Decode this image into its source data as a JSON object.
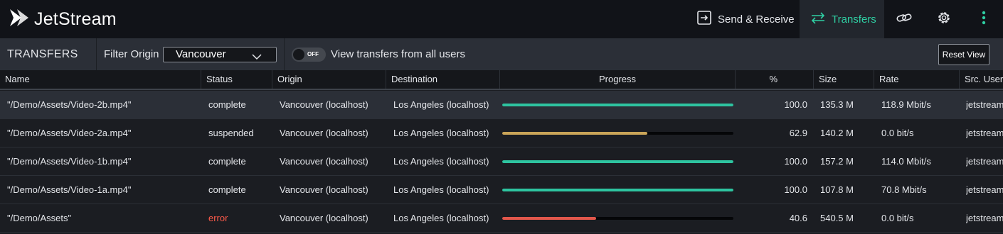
{
  "app": {
    "name": "JetStream"
  },
  "nav": {
    "send_receive": "Send & Receive",
    "transfers": "Transfers",
    "link_icon": "link-icon",
    "settings_icon": "gear-icon",
    "more_icon": "more-vertical-icon"
  },
  "toolbar": {
    "title": "TRANSFERS",
    "filter_label": "Filter Origin",
    "filter_value": "Vancouver",
    "toggle_state": "OFF",
    "toggle_label": "View transfers from all users",
    "reset_label": "Reset View"
  },
  "table": {
    "columns": [
      "Name",
      "Status",
      "Origin",
      "Destination",
      "Progress",
      "%",
      "Size",
      "Rate",
      "Src. User"
    ],
    "rows": [
      {
        "name": "\"/Demo/Assets/Video-2b.mp4\"",
        "status": "complete",
        "origin": "Vancouver (localhost)",
        "destination": "Los Angeles (localhost)",
        "progress": 100.0,
        "percent": "100.0",
        "size": "135.3 M",
        "rate": "118.9 Mbit/s",
        "user": "jetstream",
        "selected": true
      },
      {
        "name": "\"/Demo/Assets/Video-2a.mp4\"",
        "status": "suspended",
        "origin": "Vancouver (localhost)",
        "destination": "Los Angeles (localhost)",
        "progress": 62.9,
        "percent": "62.9",
        "size": "140.2 M",
        "rate": "0.0 bit/s",
        "user": "jetstream",
        "selected": false
      },
      {
        "name": "\"/Demo/Assets/Video-1b.mp4\"",
        "status": "complete",
        "origin": "Vancouver (localhost)",
        "destination": "Los Angeles (localhost)",
        "progress": 100.0,
        "percent": "100.0",
        "size": "157.2 M",
        "rate": "114.0 Mbit/s",
        "user": "jetstream",
        "selected": false
      },
      {
        "name": "\"/Demo/Assets/Video-1a.mp4\"",
        "status": "complete",
        "origin": "Vancouver (localhost)",
        "destination": "Los Angeles (localhost)",
        "progress": 100.0,
        "percent": "100.0",
        "size": "107.8 M",
        "rate": "70.8 Mbit/s",
        "user": "jetstream",
        "selected": false
      },
      {
        "name": "\"/Demo/Assets\"",
        "status": "error",
        "origin": "Vancouver (localhost)",
        "destination": "Los Angeles (localhost)",
        "progress": 40.6,
        "percent": "40.6",
        "size": "540.5 M",
        "rate": "0.0 bit/s",
        "user": "jetstream",
        "selected": false
      }
    ]
  },
  "colors": {
    "accent": "#2fcfa3",
    "complete": "#2ec4a0",
    "suspended": "#c9a458",
    "error": "#e2574b",
    "error_text": "#ff5a4a"
  }
}
